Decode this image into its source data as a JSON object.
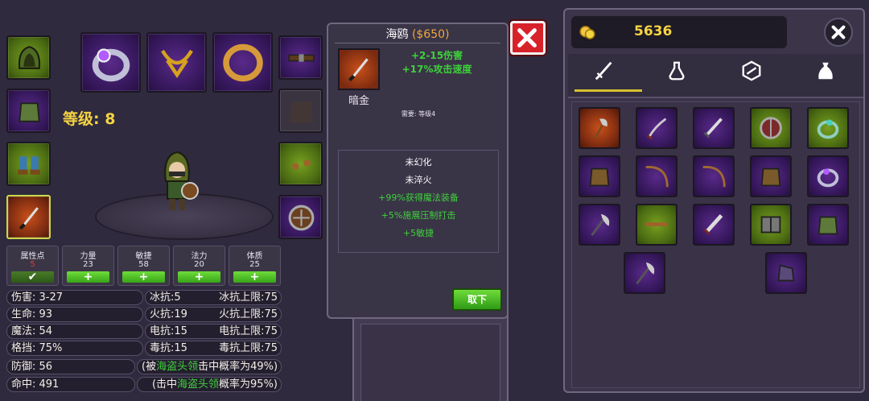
{
  "character": {
    "level_label": "等级: 8"
  },
  "attributes": {
    "points_label": "属性点",
    "points_value": "5",
    "confirm_icon": "checkmark-icon",
    "stats": [
      {
        "label": "力量",
        "value": "23",
        "button": "+"
      },
      {
        "label": "敏捷",
        "value": "58",
        "button": "+"
      },
      {
        "label": "法力",
        "value": "20",
        "button": "+"
      },
      {
        "label": "体质",
        "value": "25",
        "button": "+"
      }
    ]
  },
  "combat_stats": {
    "left": [
      "伤害: 3-27",
      "生命: 93",
      "魔法: 54",
      "格挡: 75%",
      "防御: 56",
      "命中: 491"
    ],
    "mid": [
      "冰抗:5",
      "火抗:19",
      "电抗:15",
      "毒抗:15"
    ],
    "right": [
      "冰抗上限:75",
      "火抗上限:75",
      "电抗上限:75",
      "毒抗上限:75"
    ],
    "dodge": {
      "pre": "(被",
      "highlight": "海盗头领",
      "post": "击中概率为49%)"
    },
    "hit": {
      "pre": "(击中",
      "highlight": "海盗头领",
      "post": "概率为95%)"
    }
  },
  "item_tooltip": {
    "name": "海鸥",
    "price": "($650)",
    "stat1": "+2-15伤害",
    "stat2": "+17%攻击速度",
    "quality": "暗金",
    "requirement": "需要: 等级4",
    "line1": "未幻化",
    "line2": "未淬火",
    "bonus1": "+99%获得魔法装备",
    "bonus2": "+5%施展压制打击",
    "bonus3": "+5敏捷",
    "unequip_button": "取下",
    "close_icon": "close-icon"
  },
  "inventory": {
    "gold_icon": "gold-coins-icon",
    "gold": "5636",
    "close_icon": "close-icon",
    "tabs": [
      "sword-icon",
      "potion-icon",
      "gem-icon",
      "bag-icon"
    ],
    "active_tab": 0
  },
  "colors": {
    "accent_green": "#3dd13a",
    "gold_text": "#f5d442",
    "price_text": "#f0a83a",
    "stat_blue": "#4fb3ff",
    "close_red": "#d8222a"
  }
}
